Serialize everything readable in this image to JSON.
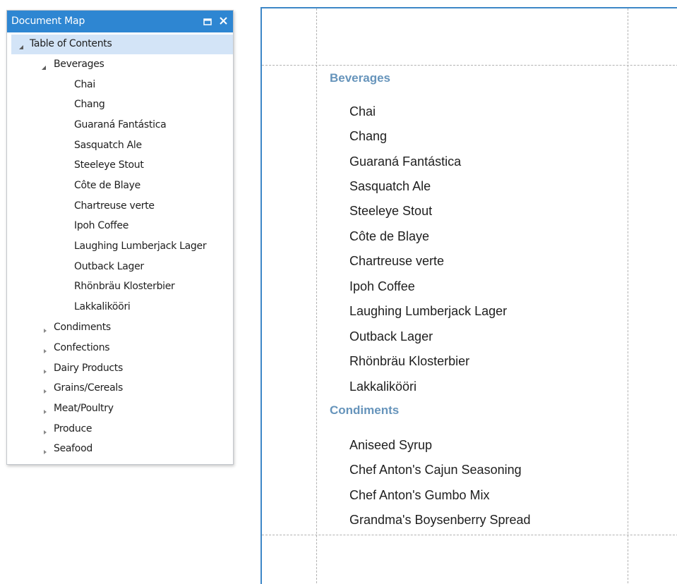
{
  "document_map": {
    "title": "Document Map",
    "maximize_icon": "maximize-icon",
    "close_icon": "close-icon",
    "root_label": "Table of Contents",
    "expanded_group": {
      "label": "Beverages",
      "items": [
        "Chai",
        "Chang",
        "Guaraná Fantástica",
        "Sasquatch Ale",
        "Steeleye Stout",
        "Côte de Blaye",
        "Chartreuse verte",
        "Ipoh Coffee",
        "Laughing Lumberjack Lager",
        "Outback Lager",
        "Rhönbräu Klosterbier",
        "Lakkalikööri"
      ]
    },
    "collapsed_groups": [
      "Condiments",
      "Confections",
      "Dairy Products",
      "Grains/Cereals",
      "Meat/Poultry",
      "Produce",
      "Seafood"
    ]
  },
  "report": {
    "groups": [
      {
        "heading": "Beverages",
        "items": [
          "Chai",
          "Chang",
          "Guaraná Fantástica",
          "Sasquatch Ale",
          "Steeleye Stout",
          "Côte de Blaye",
          "Chartreuse verte",
          "Ipoh Coffee",
          "Laughing Lumberjack Lager",
          "Outback Lager",
          "Rhönbräu Klosterbier",
          "Lakkalikööri"
        ]
      },
      {
        "heading": "Condiments",
        "items": [
          "Aniseed Syrup",
          "Chef Anton's Cajun Seasoning",
          "Chef Anton's Gumbo Mix",
          "Grandma's Boysenberry Spread"
        ]
      }
    ]
  },
  "colors": {
    "titlebar": "#2e86d2",
    "selection": "#d3e4f7",
    "heading": "#6694bb",
    "page_border": "#3d87c7"
  }
}
